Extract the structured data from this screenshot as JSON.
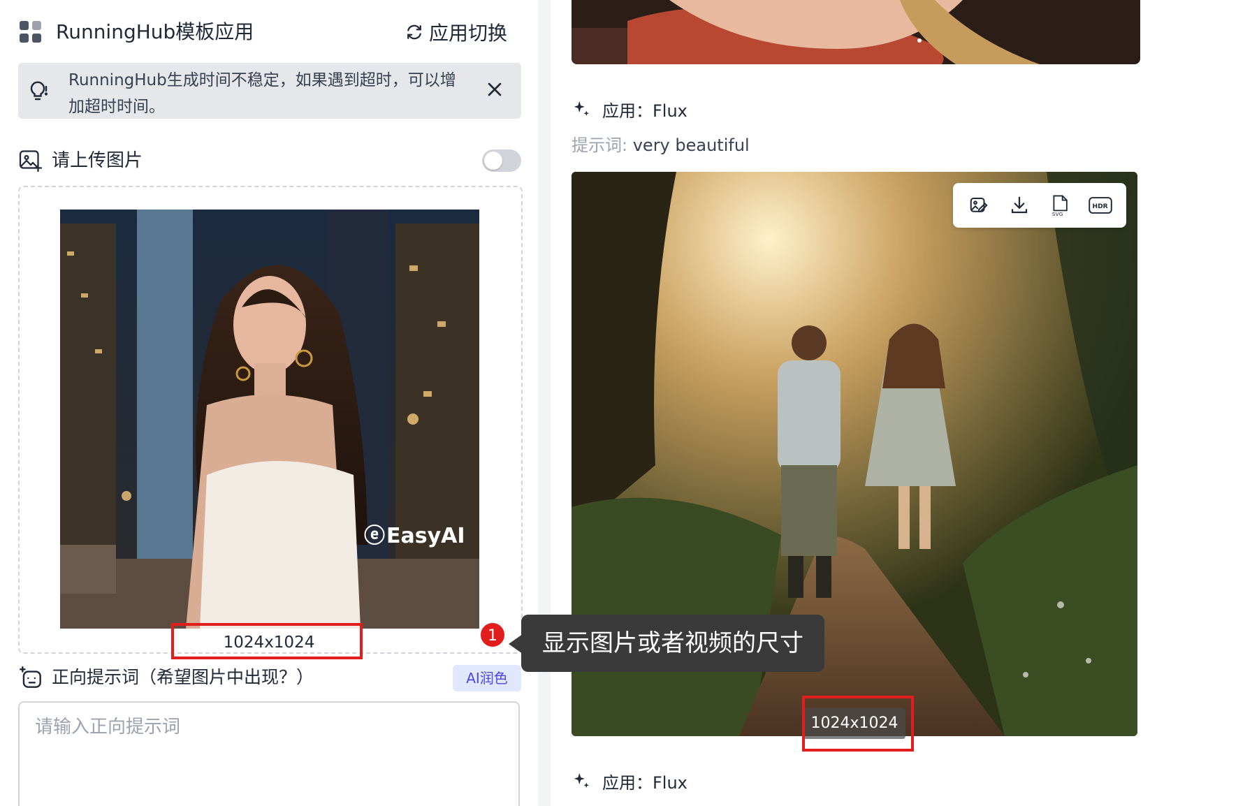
{
  "header": {
    "title": "RunningHub模板应用",
    "switch_label": "应用切换"
  },
  "notice": {
    "text": "RunningHub生成时间不稳定，如果遇到超时，可以增加超时时间。"
  },
  "upload": {
    "label": "请上传图片",
    "toggle_on": false,
    "image_watermark": "EasyAI",
    "image_size": "1024x1024"
  },
  "prompt": {
    "label": "正向提示词（希望图片中出现？）",
    "ai_button": "AI润色",
    "placeholder": "请输入正向提示词",
    "value": ""
  },
  "annotation": {
    "badge": "1",
    "text": "显示图片或者视频的尺寸"
  },
  "results": [
    {
      "app_label": "应用：",
      "app_name": "Flux",
      "prompt_key": "提示词: ",
      "prompt_value": "very beautiful",
      "image_size": "1024x1024"
    },
    {
      "app_label": "应用：",
      "app_name": "Flux"
    }
  ],
  "toolbar": {
    "svg_label": "SVG",
    "hdr_label": "HDR"
  },
  "colors": {
    "accent": "#4f46e5",
    "highlight": "#e11d1d"
  }
}
